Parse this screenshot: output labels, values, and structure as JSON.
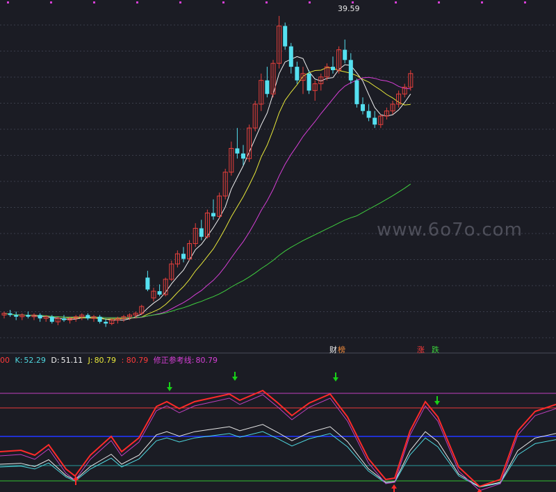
{
  "colors": {
    "background": "#1b1c24",
    "grid": "#3a3d4a",
    "up": "#e8403c",
    "down": "#55e0f0",
    "ma_white": "#f2f2f2",
    "ma_yellow": "#e8e83a",
    "ma_magenta": "#d63fd6",
    "ma_green": "#3fd03f",
    "k_line": "#e8e8e8",
    "d_line": "#4fd8e0",
    "j_line": "#ff2a2a",
    "fix_line": "#c03fc0",
    "marker_down": "#18d018",
    "marker_up": "#ff2a2a",
    "ref_blue": "#2030d0",
    "ref_red": "#e83a3a",
    "ref_magenta": "#c03fc0",
    "ref_green": "#30c030",
    "ref_teal": "#2a9d9d"
  },
  "main": {
    "peak_label": "39.59",
    "watermark": "www.6o7o.com",
    "tag_caiwu": "财",
    "tag_bang": "榜",
    "tag_zhang": "涨",
    "tag_die": "跌"
  },
  "indicator": {
    "prefix": "00",
    "k_label": "K:",
    "k_value": "52.29",
    "d_label": "D:",
    "d_value": "51.11",
    "j_label": "J:",
    "j_value": "80.79",
    "extra_value": ": 80.79",
    "fix_label": "修正参考线:",
    "fix_value": "80.79"
  },
  "chart_data": {
    "type": "candlestick",
    "price_peak": 39.59,
    "candles_note_none": "",
    "candles": [
      [
        22.0,
        22.2,
        21.8,
        22.1
      ],
      [
        22.1,
        22.3,
        21.9,
        22.0
      ],
      [
        22.0,
        22.2,
        21.7,
        21.9
      ],
      [
        21.9,
        22.1,
        21.7,
        22.0
      ],
      [
        22.0,
        22.2,
        21.8,
        21.9
      ],
      [
        21.9,
        22.1,
        21.7,
        22.0
      ],
      [
        22.0,
        22.1,
        21.6,
        21.8
      ],
      [
        21.8,
        22.0,
        21.6,
        21.9
      ],
      [
        21.9,
        22.0,
        21.5,
        21.6
      ],
      [
        21.6,
        21.9,
        21.4,
        21.8
      ],
      [
        21.8,
        22.0,
        21.6,
        21.7
      ],
      [
        21.7,
        21.9,
        21.5,
        21.8
      ],
      [
        21.8,
        22.0,
        21.6,
        21.9
      ],
      [
        21.9,
        22.1,
        21.7,
        22.0
      ],
      [
        22.0,
        22.1,
        21.7,
        21.8
      ],
      [
        21.8,
        22.0,
        21.6,
        21.9
      ],
      [
        21.9,
        22.0,
        21.5,
        21.6
      ],
      [
        21.6,
        21.8,
        21.3,
        21.5
      ],
      [
        21.5,
        21.8,
        21.4,
        21.7
      ],
      [
        21.7,
        21.9,
        21.5,
        21.8
      ],
      [
        21.8,
        22.0,
        21.6,
        21.9
      ],
      [
        21.9,
        22.1,
        21.7,
        22.0
      ],
      [
        22.0,
        22.2,
        21.8,
        22.1
      ],
      [
        22.1,
        22.6,
        22.0,
        22.5
      ],
      [
        24.2,
        24.6,
        23.4,
        23.5
      ],
      [
        23.0,
        23.6,
        22.8,
        23.4
      ],
      [
        23.4,
        23.8,
        23.1,
        23.2
      ],
      [
        23.2,
        24.2,
        23.1,
        24.1
      ],
      [
        24.1,
        25.2,
        24.0,
        25.0
      ],
      [
        25.0,
        25.8,
        24.8,
        25.6
      ],
      [
        25.6,
        26.0,
        25.1,
        25.3
      ],
      [
        25.3,
        26.4,
        25.2,
        26.2
      ],
      [
        26.2,
        27.4,
        26.0,
        27.1
      ],
      [
        27.1,
        27.6,
        26.4,
        26.6
      ],
      [
        26.6,
        28.2,
        26.5,
        28.0
      ],
      [
        28.0,
        28.8,
        27.6,
        27.8
      ],
      [
        27.8,
        29.2,
        27.7,
        29.0
      ],
      [
        29.0,
        30.6,
        28.8,
        30.4
      ],
      [
        30.4,
        32.2,
        30.2,
        31.8
      ],
      [
        31.8,
        33.0,
        31.2,
        31.5
      ],
      [
        31.5,
        32.0,
        30.8,
        31.2
      ],
      [
        31.2,
        33.2,
        31.0,
        33.0
      ],
      [
        33.0,
        34.6,
        32.8,
        34.4
      ],
      [
        34.4,
        36.2,
        34.0,
        35.8
      ],
      [
        35.8,
        36.6,
        34.8,
        35.0
      ],
      [
        35.0,
        37.0,
        34.8,
        36.8
      ],
      [
        36.8,
        39.59,
        36.5,
        39.0
      ],
      [
        39.0,
        39.2,
        37.6,
        37.8
      ],
      [
        37.8,
        38.0,
        36.2,
        36.6
      ],
      [
        36.6,
        36.9,
        35.6,
        35.8
      ],
      [
        35.8,
        36.6,
        35.0,
        36.2
      ],
      [
        36.2,
        36.4,
        35.0,
        35.2
      ],
      [
        35.2,
        35.8,
        34.6,
        35.6
      ],
      [
        35.6,
        36.2,
        35.2,
        36.0
      ],
      [
        36.0,
        36.8,
        35.8,
        36.6
      ],
      [
        36.6,
        37.2,
        36.2,
        36.4
      ],
      [
        36.4,
        37.8,
        36.2,
        37.6
      ],
      [
        37.6,
        38.2,
        36.8,
        37.0
      ],
      [
        37.0,
        37.4,
        35.6,
        35.8
      ],
      [
        35.8,
        35.9,
        34.2,
        34.4
      ],
      [
        34.4,
        34.8,
        33.8,
        34.0
      ],
      [
        34.0,
        34.4,
        33.4,
        33.6
      ],
      [
        33.6,
        34.0,
        33.0,
        33.2
      ],
      [
        33.2,
        33.8,
        33.0,
        33.7
      ],
      [
        33.7,
        34.2,
        33.5,
        34.0
      ],
      [
        34.0,
        34.6,
        33.8,
        34.4
      ],
      [
        34.4,
        35.2,
        34.2,
        35.0
      ],
      [
        35.0,
        35.6,
        34.8,
        35.4
      ],
      [
        35.4,
        36.4,
        35.2,
        36.2
      ]
    ],
    "kdj": {
      "K": 52.29,
      "D": 51.11,
      "J": 80.79,
      "fix_reference": 80.79
    }
  }
}
